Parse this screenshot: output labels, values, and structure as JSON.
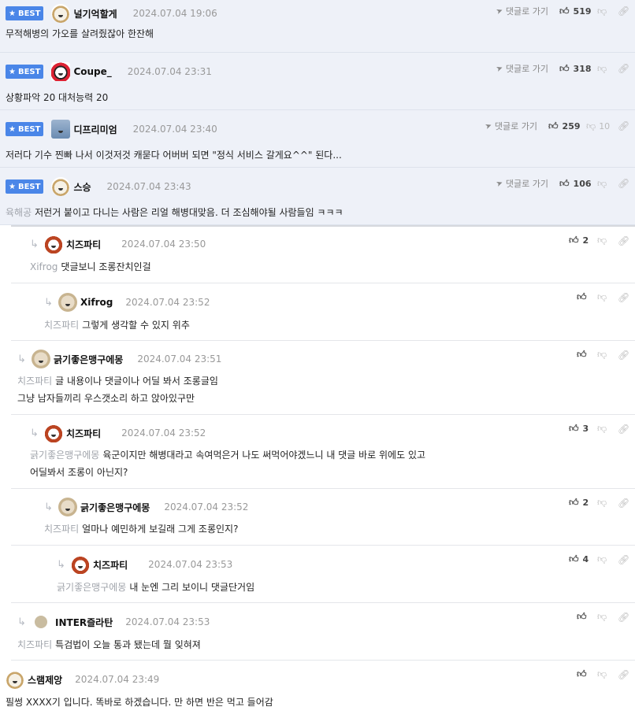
{
  "labels": {
    "best": "BEST",
    "goto_reply": "댓글로 가기"
  },
  "comments": [
    {
      "author": "널기억할게",
      "date": "2024.07.04 19:06",
      "text": "무적해병의 가오를 살려줬잖아 한잔해",
      "likes": "519",
      "dislikes": "",
      "avatar": "dog-icon"
    },
    {
      "author": "Coupe_",
      "date": "2024.07.04 23:31",
      "text": "상황파악 20 대처능력 20",
      "likes": "318",
      "dislikes": "",
      "avatar": "panda-icon"
    },
    {
      "author": "디프리미엄",
      "date": "2024.07.04 23:40",
      "text": "저러다 기수 찐빠 나서 이것저것 캐묻다 어버버 되면 \"정식 서비스 갈게요^^\" 된다...",
      "likes": "259",
      "dislikes": "10",
      "avatar": "robot-icon"
    },
    {
      "author": "스승",
      "date": "2024.07.04 23:43",
      "mention": "육해공",
      "text": "저런거 붙이고 다니는 사람은 리얼 해병대맞음. 더 조심해야될 사람들임 ㅋㅋㅋ",
      "likes": "106",
      "dislikes": "",
      "avatar": "dog-icon"
    },
    {
      "author": "치즈파티",
      "date": "2024.07.04 23:50",
      "mention": "Xifrog",
      "text": "댓글보니 조롱잔치인걸",
      "likes": "2",
      "dislikes": "",
      "avatar": "cheese-icon"
    },
    {
      "author": "Xifrog",
      "date": "2024.07.04 23:52",
      "mention": "치즈파티",
      "text": "그렇게 생각할 수 있지 위추",
      "likes": "",
      "dislikes": "",
      "avatar": "pup-icon"
    },
    {
      "author": "긁기좋은맹구에몽",
      "date": "2024.07.04 23:51",
      "mention": "치즈파티",
      "text": "글 내용이나 댓글이나 어딜 봐서 조롱글임",
      "text2": "그냥 남자들끼리 우스갯소리 하고 앉아있구만",
      "likes": "",
      "dislikes": "",
      "avatar": "pup-icon"
    },
    {
      "author": "치즈파티",
      "date": "2024.07.04 23:52",
      "mention": "긁기좋은맹구에몽",
      "text": "육군이지만 해병대라고 속여먹은거 나도 써먹어야겠느니 내 댓글 바로 위에도 있고",
      "text2": "어딜봐서 조롱이 아닌지?",
      "likes": "3",
      "dislikes": "",
      "avatar": "cheese-icon"
    },
    {
      "author": "긁기좋은맹구에몽",
      "date": "2024.07.04 23:52",
      "mention": "치즈파티",
      "text": "얼마나 예민하게 보길래 그게 조롱인지?",
      "likes": "2",
      "dislikes": "",
      "avatar": "pup-icon"
    },
    {
      "author": "치즈파티",
      "date": "2024.07.04 23:53",
      "mention": "긁기좋은맹구에몽",
      "text": "내 눈엔 그리 보이니 댓글단거임",
      "likes": "4",
      "dislikes": "",
      "avatar": "cheese-icon"
    },
    {
      "author": "INTER즐라탄",
      "date": "2024.07.04 23:53",
      "mention": "치즈파티",
      "text": "특검법이 오늘 통과 됐는데 뭘 잊혀져",
      "likes": "",
      "dislikes": "",
      "avatar": "plain-avatar"
    },
    {
      "author": "스램제앙",
      "date": "2024.07.04 23:49",
      "text": "필썽 XXXX기 입니다. 똑바로 하겠습니다. 만 하면 반은 먹고 들어감",
      "likes": "",
      "dislikes": "",
      "avatar": "dog-icon"
    }
  ]
}
